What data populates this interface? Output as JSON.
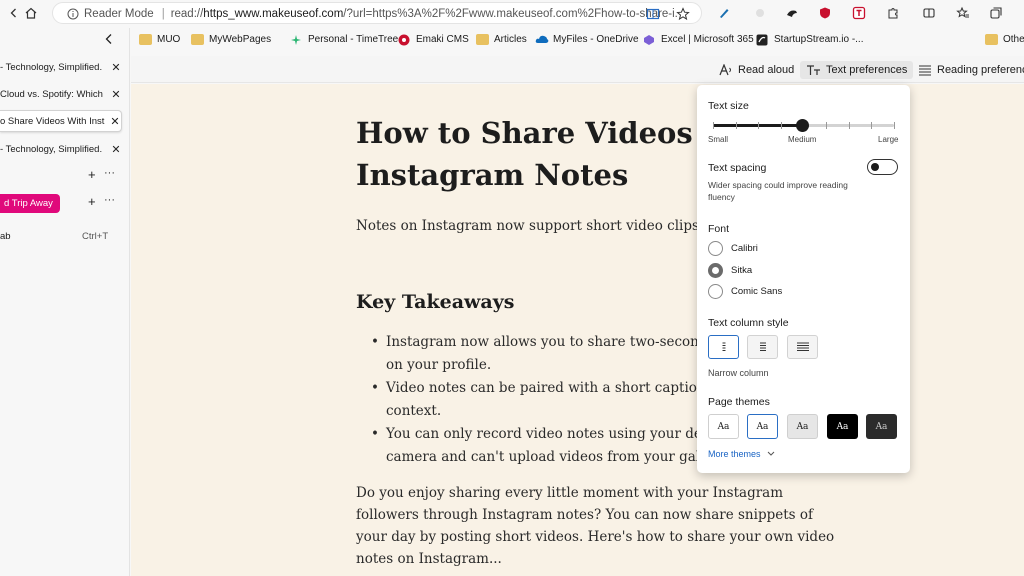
{
  "browser": {
    "reader_mode_label": "Reader Mode",
    "url_prefix": "read://",
    "url_host": "https_www.makeuseof.com",
    "url_rest": "/?url=https%3A%2F%2Fwww.makeuseof.com%2Fhow-to-share-i..."
  },
  "favorites": [
    {
      "label": "MUO",
      "icon": "folder-icon"
    },
    {
      "label": "MyWebPages",
      "icon": "folder-icon"
    },
    {
      "label": "Personal - TimeTree",
      "icon": "timetree-icon"
    },
    {
      "label": "Emaki CMS",
      "icon": "emaki-icon"
    },
    {
      "label": "Articles",
      "icon": "folder-icon"
    },
    {
      "label": "MyFiles - OneDrive",
      "icon": "onedrive-icon"
    },
    {
      "label": "Excel | Microsoft 365",
      "icon": "m365-icon"
    },
    {
      "label": "StartupStream.io -...",
      "icon": "startupstream-icon"
    },
    {
      "label": "Othe",
      "icon": "folder-icon"
    }
  ],
  "sidebar": {
    "tabs": [
      {
        "label": "- Technology, Simplified."
      },
      {
        "label": "Cloud vs. Spotify: Which"
      },
      {
        "label": "o Share Videos With Inst"
      },
      {
        "label": "- Technology, Simplified."
      }
    ],
    "group_label": "d Trip Away",
    "new_tab_label": "ab",
    "new_tab_shortcut": "Ctrl+T"
  },
  "reader_toolbar": {
    "read_aloud": "Read aloud",
    "text_preferences": "Text preferences",
    "reading_preferences": "Reading preference"
  },
  "article": {
    "title": "How to Share Videos With Instagram Notes",
    "intro": "Notes on Instagram now support short video clips. A them.",
    "takeaways_heading": "Key Takeaways",
    "bullets": [
      "Instagram now allows you to share two-second notes on your profile.",
      "Video notes can be paired with a short caption a context.",
      "You can only record video notes using your devi camera and can't upload videos from your galle"
    ],
    "body": "Do you enjoy sharing every little moment with your Instagram followers through Instagram notes? You can now share snippets of your day by posting short videos. Here's how to share your own video notes on Instagram..."
  },
  "text_panel": {
    "text_size": {
      "heading": "Text size",
      "labels": [
        "Small",
        "Medium",
        "Large"
      ],
      "value_fraction": 0.49
    },
    "text_spacing": {
      "heading": "Text spacing",
      "description": "Wider spacing could improve reading fluency",
      "enabled": false
    },
    "font": {
      "heading": "Font",
      "options": [
        "Calibri",
        "Sitka",
        "Comic Sans"
      ],
      "selected": "Sitka"
    },
    "column_style": {
      "heading": "Text column style",
      "selected_label": "Narrow column"
    },
    "themes": {
      "heading": "Page themes",
      "swatch_label": "Aa",
      "more_label": "More themes",
      "colors": [
        "#ffffff",
        "#ffffff",
        "#e6e6e6",
        "#000000",
        "#2b2b2b"
      ]
    }
  },
  "colors": {
    "accent": "#2a6ec4",
    "article_bg": "#f9f2e6",
    "group_pink": "#e0097b"
  }
}
